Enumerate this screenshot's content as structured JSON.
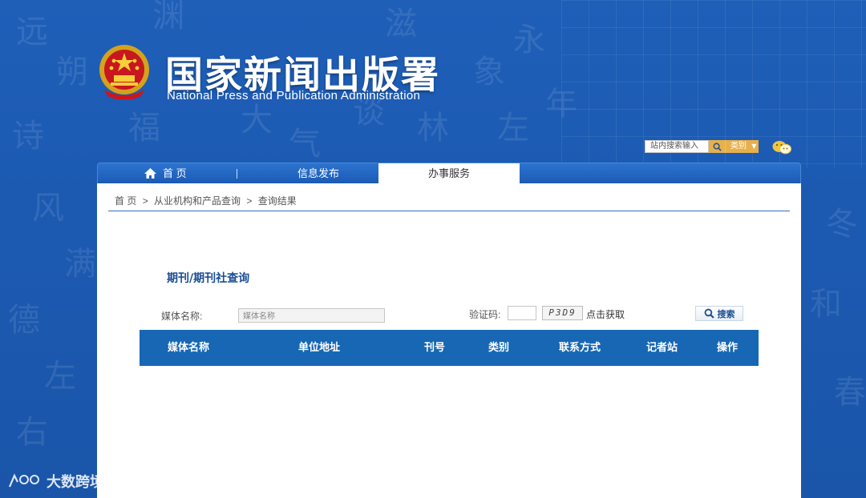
{
  "header": {
    "title": "国家新闻出版署",
    "subtitle": "National  Press and Publication Administration"
  },
  "site_search": {
    "placeholder": "站内搜索输入",
    "category_label": "类别"
  },
  "nav": {
    "items": [
      {
        "label": "首 页",
        "icon": "home-icon"
      },
      {
        "label": "信息发布"
      },
      {
        "label": "办事服务",
        "active": true
      }
    ]
  },
  "breadcrumb": {
    "items": [
      "首 页",
      "从业机构和产品查询",
      "查询结果"
    ],
    "separator": ">"
  },
  "form": {
    "title": "期刊/期刊社查询",
    "media_label": "媒体名称:",
    "media_placeholder": "媒体名称",
    "captcha_label": "验证码:",
    "captcha_code": "P3D9",
    "captcha_refresh": "点击获取",
    "search_button": "搜索"
  },
  "table": {
    "columns": [
      "媒体名称",
      "单位地址",
      "刊号",
      "类别",
      "联系方式",
      "记者站",
      "操作"
    ],
    "rows": []
  },
  "watermark": {
    "text": "大数跨境"
  },
  "colors": {
    "background": "#1c5ab2",
    "table_header": "#1767b5",
    "title_accent": "#1b4e94",
    "search_gold": "#e8b04a"
  }
}
